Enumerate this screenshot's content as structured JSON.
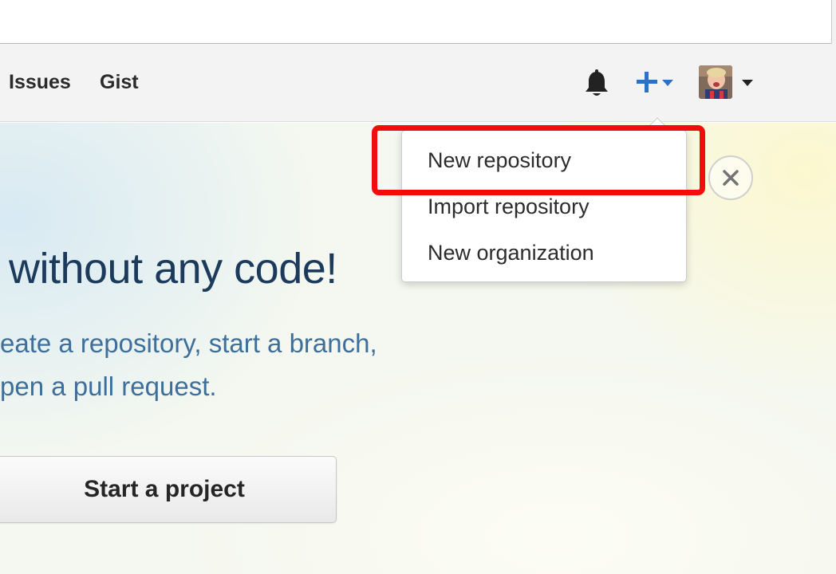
{
  "header": {
    "nav": [
      {
        "label": "Issues"
      },
      {
        "label": "Gist"
      }
    ]
  },
  "hero": {
    "title": "without any code!",
    "subtitle_line1": "eate a repository, start a branch,",
    "subtitle_line2": "pen a pull request.",
    "cta_label": "Start a project"
  },
  "create_menu": {
    "items": [
      {
        "label": "New repository"
      },
      {
        "label": "Import repository"
      },
      {
        "label": "New organization"
      }
    ]
  },
  "icons": {
    "notifications": "bell-icon",
    "create": "plus-icon",
    "dismiss": "close-icon"
  },
  "colors": {
    "accent_blue": "#2f6fc4",
    "highlight_red": "#f20d0d",
    "hero_title": "#1c3b5c",
    "hero_subtitle": "#3e6e9a"
  }
}
